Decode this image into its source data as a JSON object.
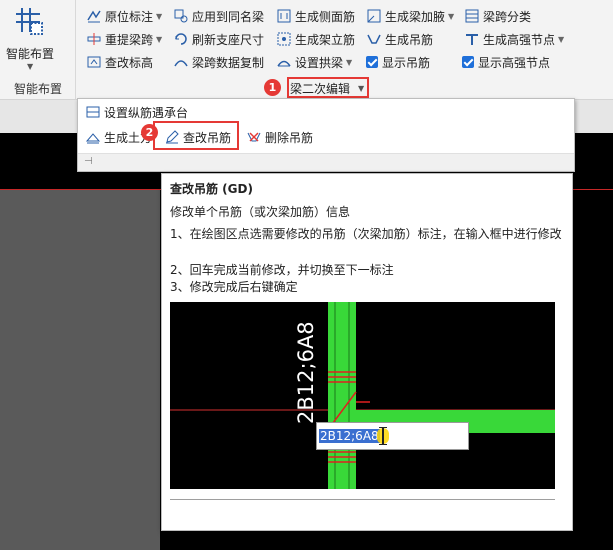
{
  "ribbon": {
    "smart_layout": {
      "label": "智能布置",
      "group_label": "智能布置"
    },
    "col1": [
      "原位标注",
      "重提梁跨",
      "查改标高"
    ],
    "col2": [
      "应用到同名梁",
      "刷新支座尺寸",
      "梁跨数据复制"
    ],
    "col3": [
      "生成侧面筋",
      "生成架立筋",
      "设置拱梁"
    ],
    "col4": [
      "生成梁加腋",
      "生成吊筋",
      "显示吊筋"
    ],
    "col5": [
      "梁跨分类",
      "生成高强节点",
      "显示高强节点"
    ],
    "group_title": "梁二次编辑"
  },
  "badges": {
    "one": "1",
    "two": "2"
  },
  "dropdown": {
    "item_top": "设置纵筋遇承台",
    "item_gen": "生成土方",
    "item_edit": "查改吊筋",
    "item_delete": "删除吊筋"
  },
  "tooltip": {
    "title": "查改吊筋 (GD)",
    "desc": "修改单个吊筋（或次梁加筋）信息",
    "step1": "1、在绘图区点选需要修改的吊筋（次梁加筋）标注，在输入框中进行修改",
    "step2": "2、回车完成当前修改，并切换至下一标注",
    "step3": "3、修改完成后右键确定",
    "image": {
      "vertical_label": "2B12;6A8",
      "input_value": "2B12;6A8"
    }
  },
  "colors": {
    "accent_red": "#e53935",
    "check_blue": "#1e6fd9",
    "beam_green": "#39d839",
    "rebar_red": "#e02020"
  }
}
